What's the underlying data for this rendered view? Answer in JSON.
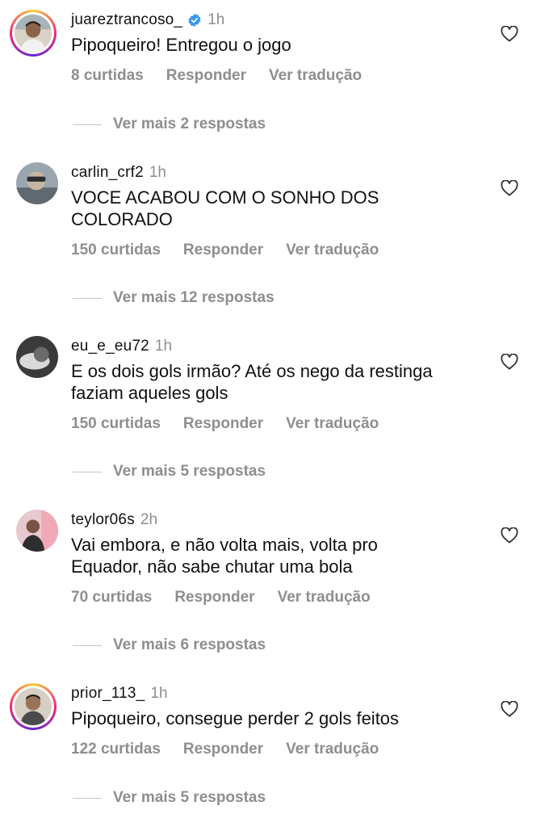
{
  "comments": [
    {
      "username": "juareztrancoso_",
      "verified": true,
      "time": "1h",
      "text": "Pipoqueiro! Entregou o jogo",
      "likes": "8 curtidas",
      "reply_label": "Responder",
      "translate_label": "Ver tradução",
      "more_replies": "Ver mais 2 respostas"
    },
    {
      "username": "carlin_crf2",
      "verified": false,
      "time": "1h",
      "text": "VOCE ACABOU COM O SONHO DOS\nCOLORADO",
      "likes": "150 curtidas",
      "reply_label": "Responder",
      "translate_label": "Ver tradução",
      "more_replies": "Ver mais 12 respostas"
    },
    {
      "username": "eu_e_eu72",
      "verified": false,
      "time": "1h",
      "text": "E os dois gols irmão? Até os nego da restinga\nfaziam aqueles gols",
      "likes": "150 curtidas",
      "reply_label": "Responder",
      "translate_label": "Ver tradução",
      "more_replies": "Ver mais 5 respostas"
    },
    {
      "username": "teylor06s",
      "verified": false,
      "time": "2h",
      "text": "Vai embora, e não volta mais, volta pro\nEquador, não sabe chutar uma bola",
      "likes": "70 curtidas",
      "reply_label": "Responder",
      "translate_label": "Ver tradução",
      "more_replies": "Ver mais 6 respostas"
    },
    {
      "username": "prior_113_",
      "verified": false,
      "time": "1h",
      "text": "Pipoqueiro, consegue perder 2 gols feitos",
      "likes": "122 curtidas",
      "reply_label": "Responder",
      "translate_label": "Ver tradução",
      "more_replies": "Ver mais 5 respostas"
    }
  ],
  "icons": {
    "like": "heart-outline-icon",
    "verified": "verified-badge-icon"
  },
  "colors": {
    "text": "#111111",
    "muted": "#8e8e8e",
    "verified": "#3897f0"
  }
}
